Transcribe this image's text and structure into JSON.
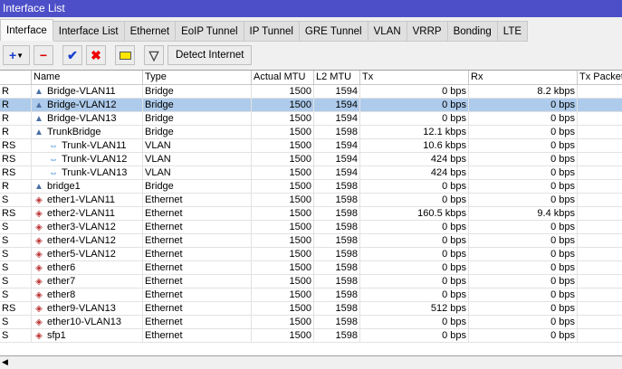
{
  "window": {
    "title": "Interface List"
  },
  "tabs": [
    "Interface",
    "Interface List",
    "Ethernet",
    "EoIP Tunnel",
    "IP Tunnel",
    "GRE Tunnel",
    "VLAN",
    "VRRP",
    "Bonding",
    "LTE"
  ],
  "toolbar": {
    "add": "+",
    "remove": "−",
    "enable": "✔",
    "disable": "✖",
    "comment": "▭",
    "filter": "▽",
    "detect": "Detect Internet"
  },
  "columns": [
    "",
    "Name",
    "Type",
    "Actual MTU",
    "L2 MTU",
    "Tx",
    "Rx",
    "Tx Packet"
  ],
  "rows": [
    {
      "flag": "R",
      "name": "Bridge-VLAN11",
      "icon": "bridge",
      "type": "Bridge",
      "mtu": "1500",
      "l2": "1594",
      "tx": "0 bps",
      "rx": "8.2 kbps"
    },
    {
      "flag": "R",
      "name": "Bridge-VLAN12",
      "icon": "bridge",
      "type": "Bridge",
      "mtu": "1500",
      "l2": "1594",
      "tx": "0 bps",
      "rx": "0 bps",
      "selected": true
    },
    {
      "flag": "R",
      "name": "Bridge-VLAN13",
      "icon": "bridge",
      "type": "Bridge",
      "mtu": "1500",
      "l2": "1594",
      "tx": "0 bps",
      "rx": "0 bps"
    },
    {
      "flag": "R",
      "name": "TrunkBridge",
      "icon": "bridge",
      "type": "Bridge",
      "mtu": "1500",
      "l2": "1598",
      "tx": "12.1 kbps",
      "rx": "0 bps"
    },
    {
      "flag": "RS",
      "name": "Trunk-VLAN11",
      "icon": "vlan",
      "type": "VLAN",
      "mtu": "1500",
      "l2": "1594",
      "tx": "10.6 kbps",
      "rx": "0 bps",
      "indent": true
    },
    {
      "flag": "RS",
      "name": "Trunk-VLAN12",
      "icon": "vlan",
      "type": "VLAN",
      "mtu": "1500",
      "l2": "1594",
      "tx": "424 bps",
      "rx": "0 bps",
      "indent": true
    },
    {
      "flag": "RS",
      "name": "Trunk-VLAN13",
      "icon": "vlan",
      "type": "VLAN",
      "mtu": "1500",
      "l2": "1594",
      "tx": "424 bps",
      "rx": "0 bps",
      "indent": true
    },
    {
      "flag": "R",
      "name": "bridge1",
      "icon": "bridge",
      "type": "Bridge",
      "mtu": "1500",
      "l2": "1598",
      "tx": "0 bps",
      "rx": "0 bps"
    },
    {
      "flag": "S",
      "name": "ether1-VLAN11",
      "icon": "eth",
      "type": "Ethernet",
      "mtu": "1500",
      "l2": "1598",
      "tx": "0 bps",
      "rx": "0 bps"
    },
    {
      "flag": "RS",
      "name": "ether2-VLAN11",
      "icon": "eth",
      "type": "Ethernet",
      "mtu": "1500",
      "l2": "1598",
      "tx": "160.5 kbps",
      "rx": "9.4 kbps"
    },
    {
      "flag": "S",
      "name": "ether3-VLAN12",
      "icon": "eth",
      "type": "Ethernet",
      "mtu": "1500",
      "l2": "1598",
      "tx": "0 bps",
      "rx": "0 bps"
    },
    {
      "flag": "S",
      "name": "ether4-VLAN12",
      "icon": "eth",
      "type": "Ethernet",
      "mtu": "1500",
      "l2": "1598",
      "tx": "0 bps",
      "rx": "0 bps"
    },
    {
      "flag": "S",
      "name": "ether5-VLAN12",
      "icon": "eth",
      "type": "Ethernet",
      "mtu": "1500",
      "l2": "1598",
      "tx": "0 bps",
      "rx": "0 bps"
    },
    {
      "flag": "S",
      "name": "ether6",
      "icon": "eth",
      "type": "Ethernet",
      "mtu": "1500",
      "l2": "1598",
      "tx": "0 bps",
      "rx": "0 bps"
    },
    {
      "flag": "S",
      "name": "ether7",
      "icon": "eth",
      "type": "Ethernet",
      "mtu": "1500",
      "l2": "1598",
      "tx": "0 bps",
      "rx": "0 bps"
    },
    {
      "flag": "S",
      "name": "ether8",
      "icon": "eth",
      "type": "Ethernet",
      "mtu": "1500",
      "l2": "1598",
      "tx": "0 bps",
      "rx": "0 bps"
    },
    {
      "flag": "RS",
      "name": "ether9-VLAN13",
      "icon": "eth",
      "type": "Ethernet",
      "mtu": "1500",
      "l2": "1598",
      "tx": "512 bps",
      "rx": "0 bps"
    },
    {
      "flag": "S",
      "name": "ether10-VLAN13",
      "icon": "eth",
      "type": "Ethernet",
      "mtu": "1500",
      "l2": "1598",
      "tx": "0 bps",
      "rx": "0 bps"
    },
    {
      "flag": "S",
      "name": "sfp1",
      "icon": "eth",
      "type": "Ethernet",
      "mtu": "1500",
      "l2": "1598",
      "tx": "0 bps",
      "rx": "0 bps"
    }
  ]
}
